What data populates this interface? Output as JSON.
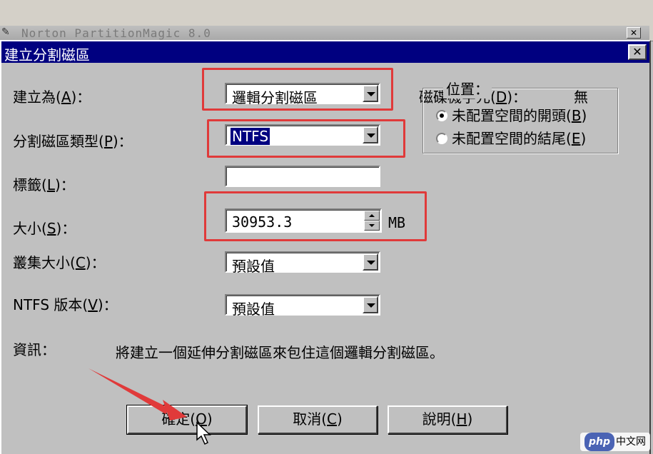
{
  "background_window": {
    "title": "Norton PartitionMagic 8.0",
    "close_symbol": "✕"
  },
  "dialog": {
    "title": "建立分割磁區",
    "close_symbol": "✕"
  },
  "fields": {
    "create_as": {
      "label": "建立為(",
      "key": "A",
      "suffix": ")：",
      "value": "邏輯分割磁區"
    },
    "partition_type": {
      "label": "分割磁區類型(",
      "key": "P",
      "suffix": ")：",
      "value": "NTFS"
    },
    "volume_label": {
      "label": "標籤(",
      "key": "L",
      "suffix": ")：",
      "value": ""
    },
    "size": {
      "label": "大小(",
      "key": "S",
      "suffix": ")：",
      "value": "30953.3",
      "unit": "MB"
    },
    "cluster_size": {
      "label": "叢集大小(",
      "key": "C",
      "suffix": ")：",
      "value": "預設值"
    },
    "ntfs_version": {
      "label": "NTFS 版本(",
      "key": "V",
      "suffix": ")：",
      "value": "預設值"
    }
  },
  "drive_letter": {
    "label": "磁碟機字元(",
    "key": "D",
    "suffix": ")：",
    "value": "無"
  },
  "position": {
    "title": "位置：",
    "options": [
      {
        "label": "未配置空間的開頭(",
        "key": "B",
        "suffix": ")",
        "selected": true
      },
      {
        "label": "未配置空間的結尾(",
        "key": "E",
        "suffix": ")",
        "selected": false
      }
    ]
  },
  "info": {
    "label": "資訊：",
    "text": "將建立一個延伸分割磁區來包住這個邏輯分割磁區。"
  },
  "buttons": {
    "ok": {
      "label": "確定(",
      "key": "O",
      "suffix": ")"
    },
    "cancel": {
      "label": "取消(",
      "key": "C",
      "suffix": ")"
    },
    "help": {
      "label": "說明(",
      "key": "H",
      "suffix": ")"
    }
  },
  "annotations": {
    "highlight_color": "#e03a3a",
    "arrow_color": "#e03a3a"
  },
  "watermark": {
    "brand": "php",
    "text": "中文网"
  }
}
